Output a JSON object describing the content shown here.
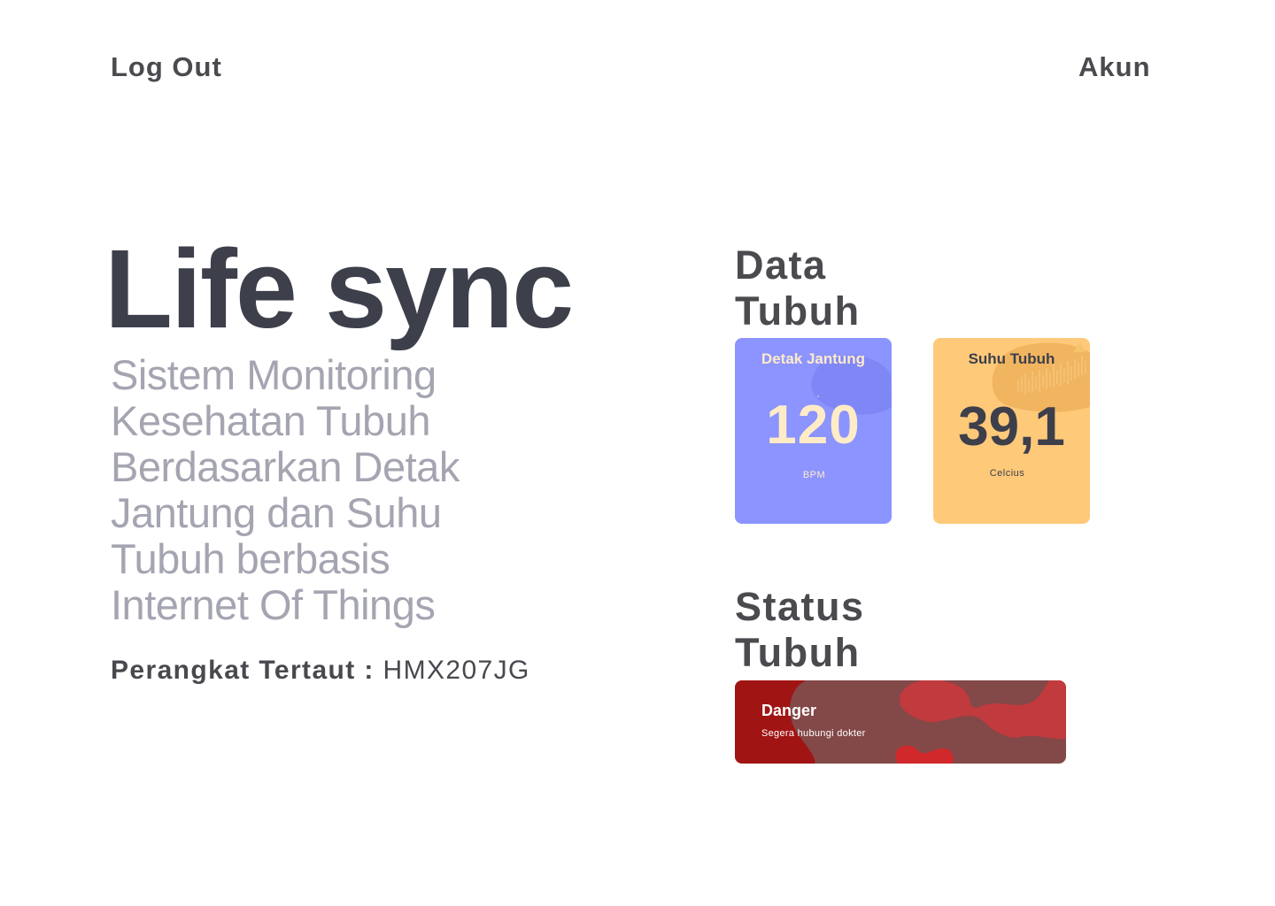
{
  "header": {
    "logout_label": "Log Out",
    "account_label": "Akun"
  },
  "hero": {
    "title": "Life sync",
    "subtitle": "Sistem Monitoring Kesehatan Tubuh Berdasarkan Detak Jantung dan Suhu Tubuh berbasis Internet Of Things",
    "device_label": "Perangkat Tertaut : ",
    "device_id": "HMX207JG"
  },
  "body_data": {
    "section_title": "Data Tubuh",
    "heart_rate": {
      "label": "Detak Jantung",
      "value": "120",
      "unit": "BPM",
      "color": "#8b94ff"
    },
    "temperature": {
      "label": "Suhu Tubuh",
      "value": "39,1",
      "unit": "Celcius",
      "color": "#ffc97a"
    }
  },
  "body_status": {
    "section_title": "Status Tubuh",
    "status": "Danger",
    "message": "Segera hubungi dokter",
    "color": "#a01414"
  }
}
